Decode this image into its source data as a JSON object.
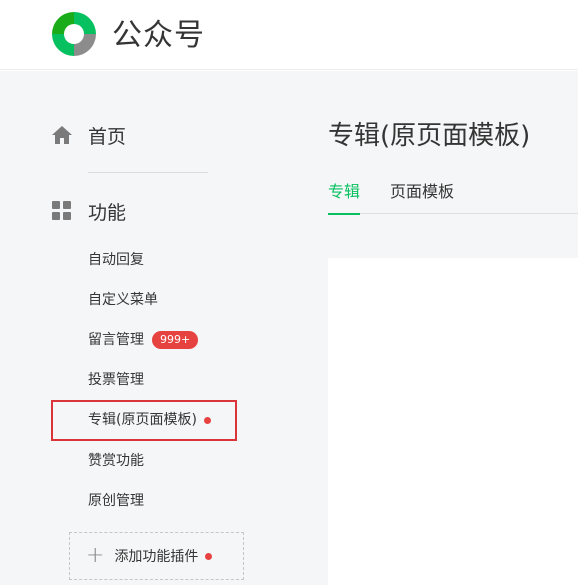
{
  "brand": {
    "name": "公众号",
    "logo_icon": "wechat-mp-logo-icon",
    "colors": {
      "green": "#07c160",
      "gray": "#8c8c8c"
    }
  },
  "sidebar": {
    "home": {
      "label": "首页",
      "icon": "home-icon"
    },
    "section": {
      "label": "功能",
      "icon": "grid-icon"
    },
    "items": [
      {
        "label": "自动回复"
      },
      {
        "label": "自定义菜单"
      },
      {
        "label": "留言管理",
        "badge": "999+"
      },
      {
        "label": "投票管理"
      },
      {
        "label": "专辑(原页面模板)",
        "dot": true,
        "selected": true
      },
      {
        "label": "赞赏功能"
      },
      {
        "label": "原创管理"
      }
    ],
    "add_plugin": {
      "label": "添加功能插件",
      "icon": "plus-icon",
      "dot": true
    },
    "badge_color": "#e64340",
    "highlight_color": "#d9353b"
  },
  "main": {
    "title": "专辑(原页面模板)",
    "tabs": [
      {
        "label": "专辑",
        "active": true
      },
      {
        "label": "页面模板",
        "active": false
      }
    ]
  }
}
